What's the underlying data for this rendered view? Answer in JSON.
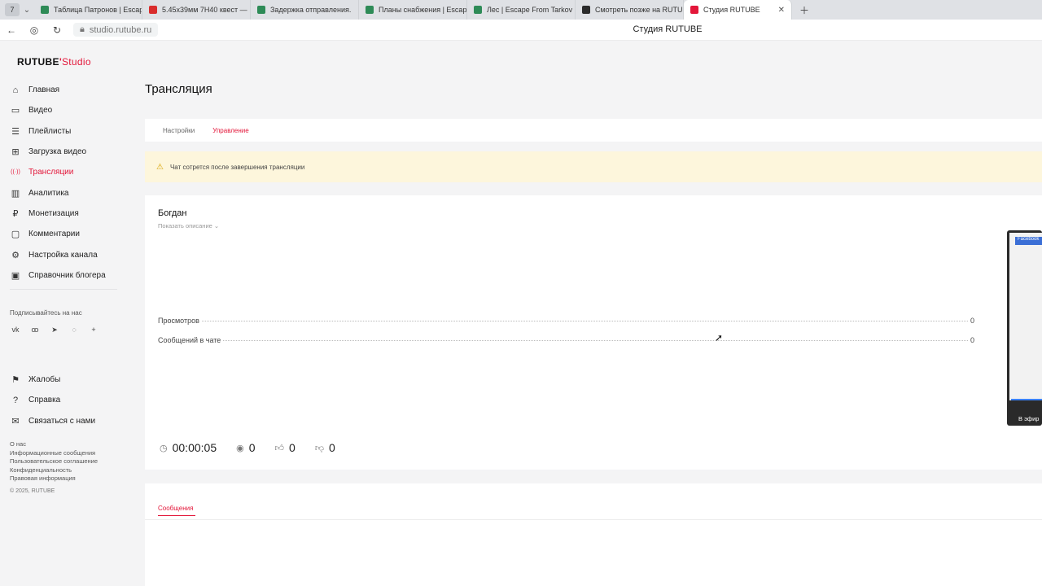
{
  "browser": {
    "tab_counter": "7",
    "tabs": [
      {
        "label": "Таблица Патронов | Escap",
        "color": "#2e8b57"
      },
      {
        "label": "5.45x39мм 7Н40 квест —",
        "color": "#d92c2c"
      },
      {
        "label": "Задержка отправления.",
        "color": "#2e8b57"
      },
      {
        "label": "Планы снабжения | Escap",
        "color": "#2e8b57"
      },
      {
        "label": "Лес | Escape From Tarkov",
        "color": "#2e8b57"
      },
      {
        "label": "Смотреть позже на RUTU",
        "color": "#2b2b2b"
      },
      {
        "label": "Студия RUTUBE",
        "color": "#e3173a"
      }
    ],
    "url": "studio.rutube.ru",
    "page_title": "Студия RUTUBE"
  },
  "logo": {
    "brand": "RUTUBE",
    "suffix": "Studio"
  },
  "sidebar": {
    "items": [
      {
        "label": "Главная",
        "icon": "home-icon",
        "glyph": "⌂"
      },
      {
        "label": "Видео",
        "icon": "video-icon",
        "glyph": "▭"
      },
      {
        "label": "Плейлисты",
        "icon": "playlist-icon",
        "glyph": "☰"
      },
      {
        "label": "Загрузка видео",
        "icon": "upload-icon",
        "glyph": "⊞"
      },
      {
        "label": "Трансляции",
        "icon": "broadcast-icon",
        "glyph": "((·))"
      },
      {
        "label": "Аналитика",
        "icon": "analytics-icon",
        "glyph": "▥"
      },
      {
        "label": "Монетизация",
        "icon": "monetization-icon",
        "glyph": "₽"
      },
      {
        "label": "Комментарии",
        "icon": "comments-icon",
        "glyph": "▢"
      },
      {
        "label": "Настройка канала",
        "icon": "settings-icon",
        "glyph": "⚙"
      },
      {
        "label": "Справочник блогера",
        "icon": "book-icon",
        "glyph": "▣"
      }
    ],
    "subscribe_label": "Подписывайтесь на нас",
    "socials": [
      "vk-icon",
      "ok-icon",
      "telegram-icon",
      "viber-icon",
      "plus-icon"
    ],
    "socials_glyphs": [
      "vk",
      "ꝏ",
      "➤",
      "◌",
      "+"
    ],
    "items2": [
      {
        "label": "Жалобы",
        "icon": "flag-icon",
        "glyph": "⚑"
      },
      {
        "label": "Справка",
        "icon": "help-icon",
        "glyph": "?"
      },
      {
        "label": "Связаться с нами",
        "icon": "mail-icon",
        "glyph": "✉"
      }
    ],
    "footer_links": [
      "О нас",
      "Информационные сообщения",
      "Пользовательское соглашение",
      "Конфиденциальность",
      "Правовая информация"
    ],
    "copyright": "© 2025, RUTUBE"
  },
  "main": {
    "title": "Трансляция",
    "tabs": [
      "Настройки",
      "Управление"
    ],
    "alert": "Чат сотрется после завершения трансляции",
    "stream": {
      "name": "Богдан",
      "show_description": "Показать описание",
      "stats": [
        {
          "label": "Просмотров",
          "value": "0"
        },
        {
          "label": "Сообщений в чате",
          "value": "0"
        }
      ],
      "duration": "00:00:05",
      "viewers": "0",
      "likes": "0",
      "dislikes": "0"
    },
    "preview": {
      "badge": "Facebook",
      "live_label": "В эфир"
    },
    "messages_tab": "Сообщения"
  }
}
